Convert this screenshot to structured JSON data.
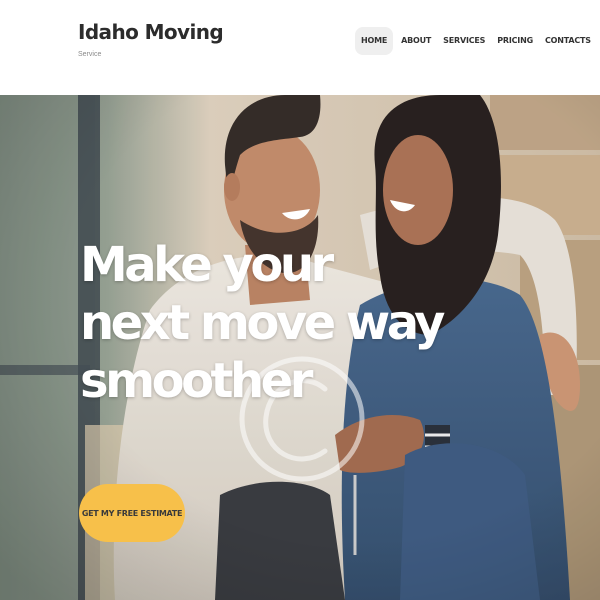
{
  "brand": {
    "title": "Idaho Moving",
    "subtitle": "Service"
  },
  "nav": {
    "items": [
      {
        "label": "HOME",
        "active": true
      },
      {
        "label": "ABOUT"
      },
      {
        "label": "SERVICES"
      },
      {
        "label": "PRICING"
      },
      {
        "label": "CONTACTS"
      }
    ]
  },
  "hero": {
    "headline": [
      "Make your",
      "next move way",
      "smoother"
    ],
    "cta_label": "GET MY FREE ESTIMATE",
    "watermark_icon": "copyright-icon"
  },
  "colors": {
    "accent": "#f7c04a",
    "text_dark": "#2c2c2c",
    "nav_active_bg": "#efefef",
    "hero_text": "#ffffff"
  }
}
